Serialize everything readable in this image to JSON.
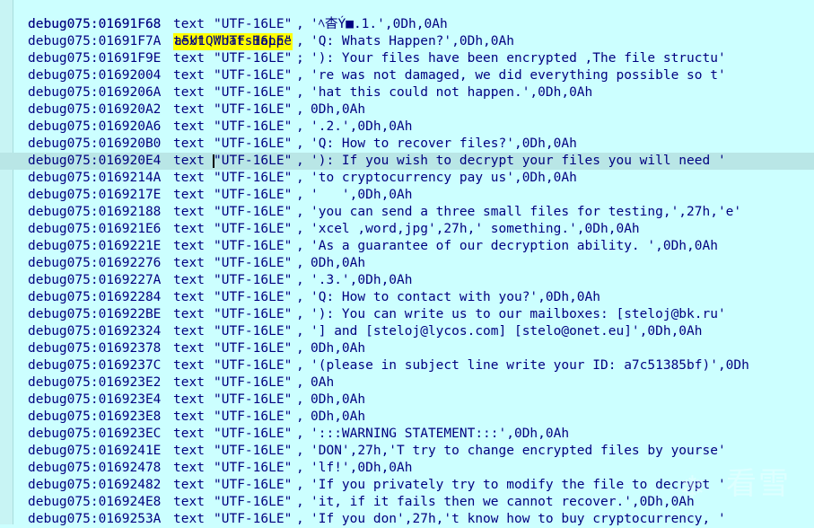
{
  "label": {
    "address": "debug075:01691F68",
    "name": "a5U1QWhatsHappe",
    "suffix": ":"
  },
  "rows": [
    {
      "address": "debug075:01691F68",
      "directive": "text",
      "encoding": "\"UTF-16LE\"",
      "value": "'ﾍ杳Ý■.1.',0Dh,0Ah"
    },
    {
      "address": "debug075:01691F7A",
      "directive": "text",
      "encoding": "\"UTF-16LE\"",
      "value": "'Q: Whats Happen?',0Dh,0Ah"
    },
    {
      "address": "debug075:01691F9E",
      "directive": "text",
      "encoding": "\"UTF-16LE\"",
      "value": "'): Your files have been encrypted ,The file structu'"
    },
    {
      "address": "debug075:01692004",
      "directive": "text",
      "encoding": "\"UTF-16LE\"",
      "value": "'re was not damaged, we did everything possible so t'"
    },
    {
      "address": "debug075:0169206A",
      "directive": "text",
      "encoding": "\"UTF-16LE\"",
      "value": "'hat this could not happen.',0Dh,0Ah"
    },
    {
      "address": "debug075:016920A2",
      "directive": "text",
      "encoding": "\"UTF-16LE\"",
      "value": "0Dh,0Ah"
    },
    {
      "address": "debug075:016920A6",
      "directive": "text",
      "encoding": "\"UTF-16LE\"",
      "value": "'.2.',0Dh,0Ah"
    },
    {
      "address": "debug075:016920B0",
      "directive": "text",
      "encoding": "\"UTF-16LE\"",
      "value": "'Q: How to recover files?',0Dh,0Ah"
    },
    {
      "address": "debug075:016920E4",
      "directive": "text",
      "encoding": "\"UTF-16LE\"",
      "value": "'): If you wish to decrypt your files you will need '"
    },
    {
      "address": "debug075:0169214A",
      "directive": "text",
      "encoding": "\"UTF-16LE\"",
      "value": "'to cryptocurrency pay us',0Dh,0Ah"
    },
    {
      "address": "debug075:0169217E",
      "directive": "text",
      "encoding": "\"UTF-16LE\"",
      "value": "'   ',0Dh,0Ah"
    },
    {
      "address": "debug075:01692188",
      "directive": "text",
      "encoding": "\"UTF-16LE\"",
      "value": "'you can send a three small files for testing,',27h,'e'"
    },
    {
      "address": "debug075:016921E6",
      "directive": "text",
      "encoding": "\"UTF-16LE\"",
      "value": "'xcel ,word,jpg',27h,' something.',0Dh,0Ah"
    },
    {
      "address": "debug075:0169221E",
      "directive": "text",
      "encoding": "\"UTF-16LE\"",
      "value": "'As a guarantee of our decryption ability. ',0Dh,0Ah"
    },
    {
      "address": "debug075:01692276",
      "directive": "text",
      "encoding": "\"UTF-16LE\"",
      "value": "0Dh,0Ah"
    },
    {
      "address": "debug075:0169227A",
      "directive": "text",
      "encoding": "\"UTF-16LE\"",
      "value": "'.3.',0Dh,0Ah"
    },
    {
      "address": "debug075:01692284",
      "directive": "text",
      "encoding": "\"UTF-16LE\"",
      "value": "'Q: How to contact with you?',0Dh,0Ah"
    },
    {
      "address": "debug075:016922BE",
      "directive": "text",
      "encoding": "\"UTF-16LE\"",
      "value": "'): You can write us to our mailboxes: [steloj@bk.ru'"
    },
    {
      "address": "debug075:01692324",
      "directive": "text",
      "encoding": "\"UTF-16LE\"",
      "value": "'] and [steloj@lycos.com] [stelo@onet.eu]',0Dh,0Ah"
    },
    {
      "address": "debug075:01692378",
      "directive": "text",
      "encoding": "\"UTF-16LE\"",
      "value": "0Dh,0Ah"
    },
    {
      "address": "debug075:0169237C",
      "directive": "text",
      "encoding": "\"UTF-16LE\"",
      "value": "'(please in subject line write your ID: a7c51385bf)',0Dh"
    },
    {
      "address": "debug075:016923E2",
      "directive": "text",
      "encoding": "\"UTF-16LE\"",
      "value": "0Ah"
    },
    {
      "address": "debug075:016923E4",
      "directive": "text",
      "encoding": "\"UTF-16LE\"",
      "value": "0Dh,0Ah"
    },
    {
      "address": "debug075:016923E8",
      "directive": "text",
      "encoding": "\"UTF-16LE\"",
      "value": "0Dh,0Ah"
    },
    {
      "address": "debug075:016923EC",
      "directive": "text",
      "encoding": "\"UTF-16LE\"",
      "value": "':::WARNING STATEMENT:::',0Dh,0Ah"
    },
    {
      "address": "debug075:0169241E",
      "directive": "text",
      "encoding": "\"UTF-16LE\"",
      "value": "'DON',27h,'T try to change encrypted files by yourse'"
    },
    {
      "address": "debug075:01692478",
      "directive": "text",
      "encoding": "\"UTF-16LE\"",
      "value": "'lf!',0Dh,0Ah"
    },
    {
      "address": "debug075:01692482",
      "directive": "text",
      "encoding": "\"UTF-16LE\"",
      "value": "'If you privately try to modify the file to decrypt '"
    },
    {
      "address": "debug075:016924E8",
      "directive": "text",
      "encoding": "\"UTF-16LE\"",
      "value": "'it, if it fails then we cannot recover.',0Dh,0Ah"
    },
    {
      "address": "debug075:0169253A",
      "directive": "text",
      "encoding": "\"UTF-16LE\"",
      "value": "'If you don',27h,'t know how to buy cryptocurrency, '"
    }
  ],
  "highlighted_row": 8,
  "watermark": {
    "icon": "snowflake-icon",
    "brand": "看雪"
  },
  "colors": {
    "background": "#ccffff",
    "text": "#000080",
    "label_highlight": "#ffff00",
    "current_line": "#b9e6e6"
  }
}
